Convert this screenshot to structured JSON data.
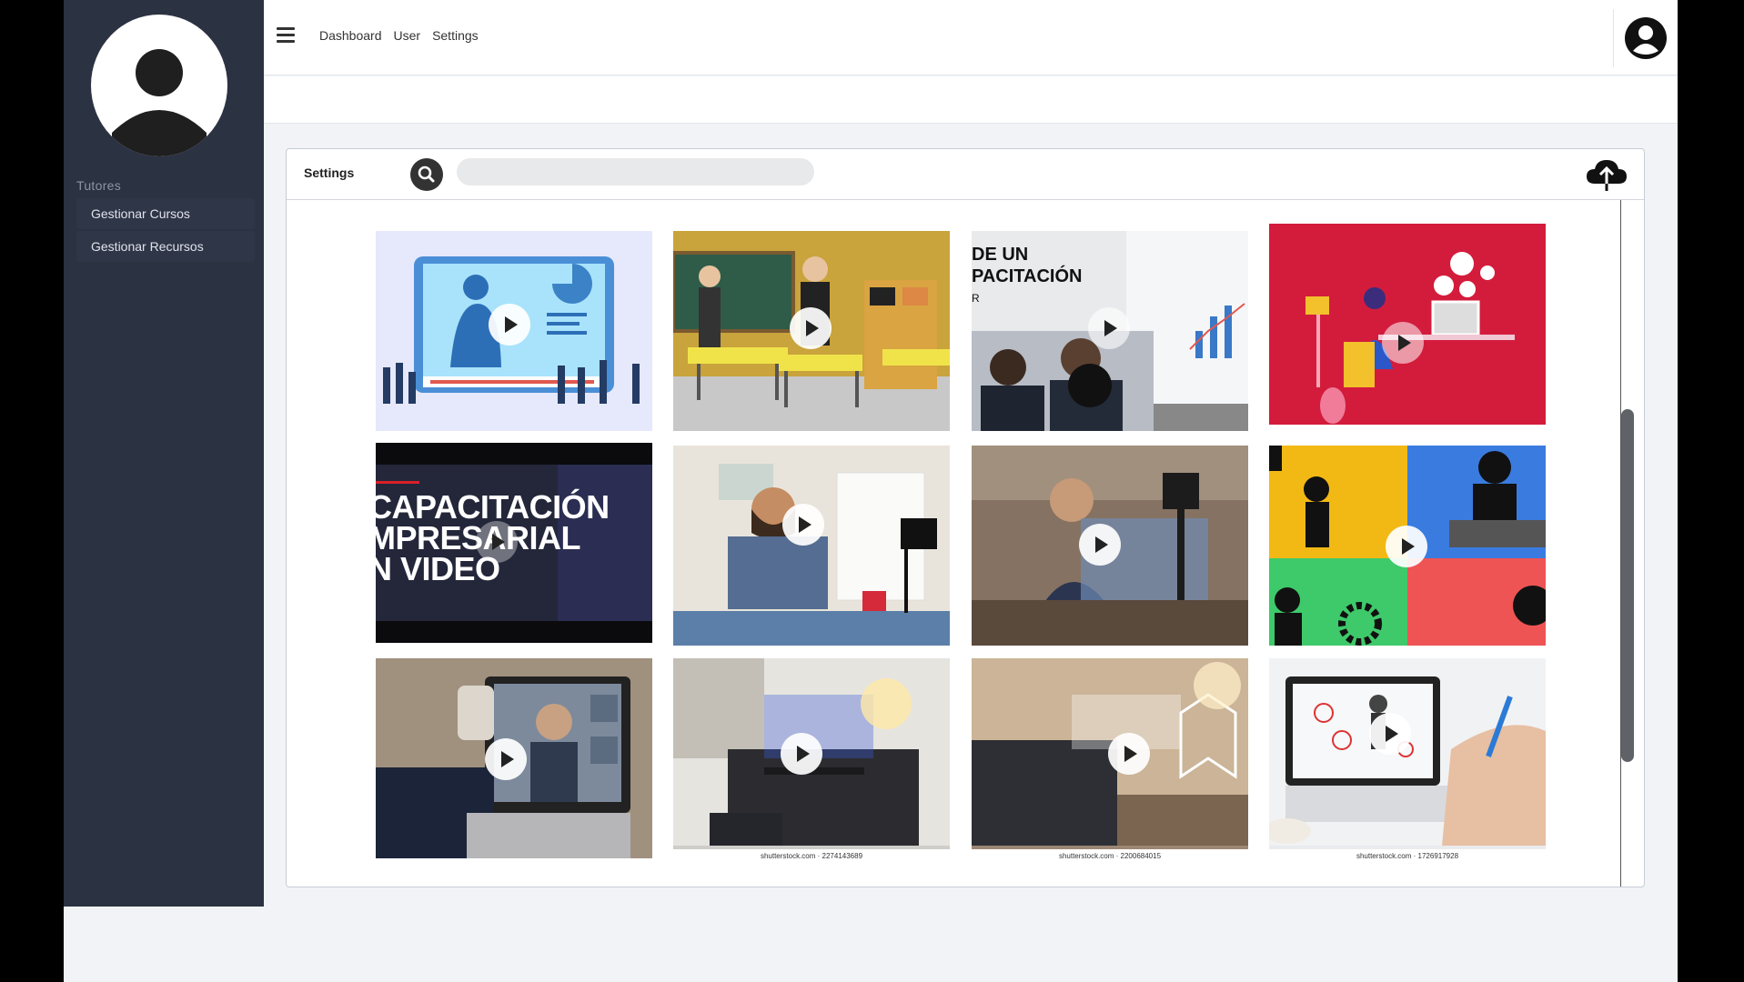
{
  "sidebar": {
    "section_title": "Tutores",
    "items": [
      {
        "label": "Gestionar Cursos"
      },
      {
        "label": "Gestionar Recursos"
      }
    ]
  },
  "topbar": {
    "menu_icon": "hamburger-icon",
    "nav": [
      "Dashboard",
      "User",
      "Settings"
    ],
    "avatar_icon": "user-avatar-icon"
  },
  "panel": {
    "title": "Settings",
    "search_icon": "search-icon",
    "search_placeholder": "",
    "upload_icon": "cloud-upload-icon"
  },
  "videos": [
    {
      "caption": "",
      "icon": "play-icon"
    },
    {
      "caption": "",
      "icon": "play-icon"
    },
    {
      "text_lines": [
        "DE UN",
        "PACITACIÓN",
        "R"
      ],
      "caption": "",
      "icon": "play-icon"
    },
    {
      "caption": "",
      "icon": "play-icon"
    },
    {
      "text_lines": [
        "CAPACITACIÓN",
        "MPRESARIAL",
        "N VIDEO"
      ],
      "caption": "",
      "icon": "play-icon"
    },
    {
      "caption": "",
      "icon": "play-icon"
    },
    {
      "caption": "",
      "icon": "play-icon"
    },
    {
      "caption": "",
      "icon": "play-icon"
    },
    {
      "caption": "",
      "icon": "play-icon"
    },
    {
      "caption": "shutterstock.com · 2274143689",
      "icon": "play-icon"
    },
    {
      "caption": "shutterstock.com · 2200684015",
      "icon": "play-icon"
    },
    {
      "caption": "shutterstock.com · 1726917928",
      "icon": "play-icon"
    }
  ],
  "colors": {
    "sidebar_bg": "#2b3242",
    "app_bg": "#f1f3f7",
    "accent_dark": "#333333"
  }
}
